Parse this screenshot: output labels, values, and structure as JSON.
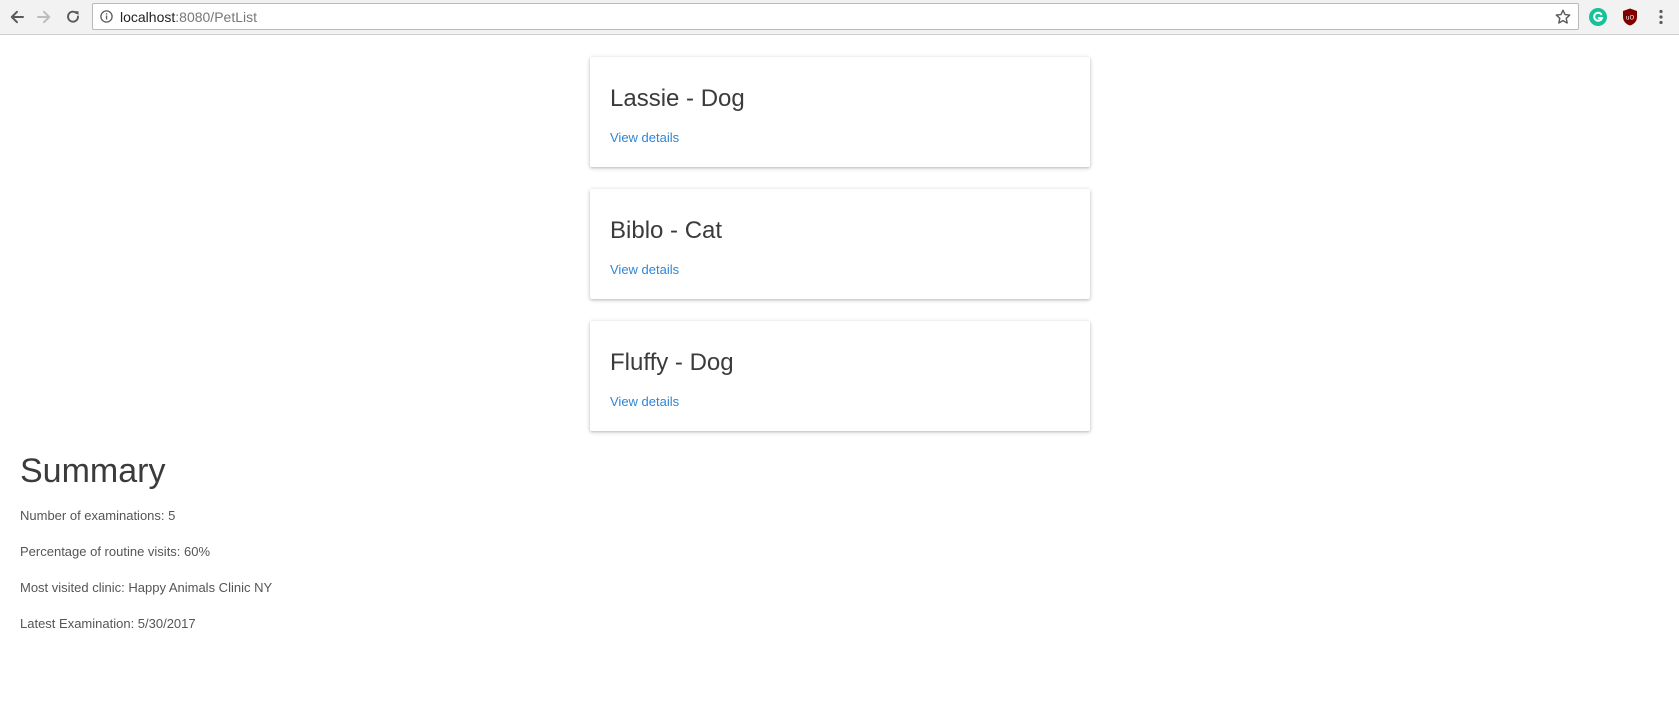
{
  "browser": {
    "url_host": "localhost",
    "url_path": ":8080/PetList",
    "icons": {
      "back": "back-arrow-icon",
      "forward": "forward-arrow-icon",
      "reload": "reload-icon",
      "info": "info-icon",
      "bookmark": "star-icon",
      "extension_1": "grammarly-icon",
      "extension_2": "ublock-icon",
      "menu": "kebab-menu-icon"
    },
    "colors": {
      "grammarly": "#15c39a",
      "ublock": "#800000"
    }
  },
  "pets": [
    {
      "title": "Lassie - Dog",
      "link": "View details"
    },
    {
      "title": "Biblo - Cat",
      "link": "View details"
    },
    {
      "title": "Fluffy - Dog",
      "link": "View details"
    }
  ],
  "summary": {
    "heading": "Summary",
    "lines": [
      "Number of examinations: 5",
      "Percentage of routine visits: 60%",
      "Most visited clinic: Happy Animals Clinic NY",
      "Latest Examination: 5/30/2017"
    ]
  },
  "colors": {
    "link": "#2f86d6",
    "heading_text": "#3b3b3b",
    "body_text": "#555555"
  }
}
